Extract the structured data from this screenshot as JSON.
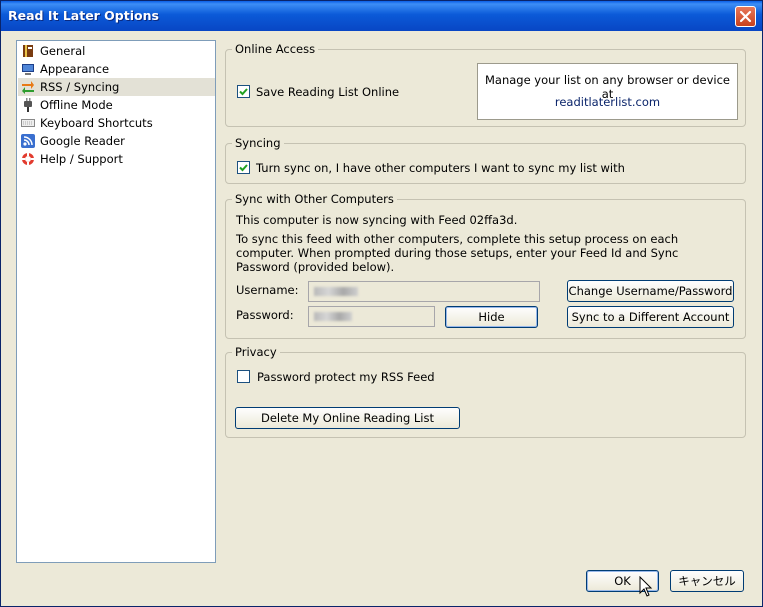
{
  "window": {
    "title": "Read It Later Options",
    "close_icon": "close-icon"
  },
  "sidebar": {
    "items": [
      {
        "label": "General",
        "icon": "book-icon"
      },
      {
        "label": "Appearance",
        "icon": "monitor-icon"
      },
      {
        "label": "RSS / Syncing",
        "icon": "sync-arrows-icon",
        "selected": true
      },
      {
        "label": "Offline Mode",
        "icon": "plug-icon"
      },
      {
        "label": "Keyboard Shortcuts",
        "icon": "keyboard-icon"
      },
      {
        "label": "Google Reader",
        "icon": "rss-feed-icon"
      },
      {
        "label": "Help / Support",
        "icon": "lifebuoy-icon"
      }
    ]
  },
  "online_access": {
    "legend": "Online Access",
    "save_online_label": "Save Reading List Online",
    "save_online_checked": true,
    "info_text": "Manage your list on any browser or device at",
    "link": "readitlaterlist.com"
  },
  "syncing": {
    "legend": "Syncing",
    "sync_label": "Turn sync on, I have other computers I want to sync my list with",
    "sync_checked": true
  },
  "sync_other": {
    "legend": "Sync with Other Computers",
    "status_text": "This computer is now syncing with Feed 02ffa3d.",
    "instructions": "To sync this feed with other computers, complete this setup process on each computer. When prompted during those setups, enter your Feed Id and Sync Password (provided below).",
    "username_label": "Username:",
    "password_label": "Password:",
    "hide_button": "Hide",
    "change_button": "Change Username/Password",
    "sync_diff_button": "Sync to a Different Account"
  },
  "privacy": {
    "legend": "Privacy",
    "protect_label": "Password protect my RSS Feed",
    "protect_checked": false,
    "delete_button": "Delete My Online Reading List"
  },
  "footer": {
    "ok_button": "OK",
    "cancel_button": "キャンセル"
  },
  "colors": {
    "title_bar": "#0b5ad8",
    "dialog_bg": "#ece9d8",
    "link": "#0a246a",
    "check": "#21a121"
  }
}
